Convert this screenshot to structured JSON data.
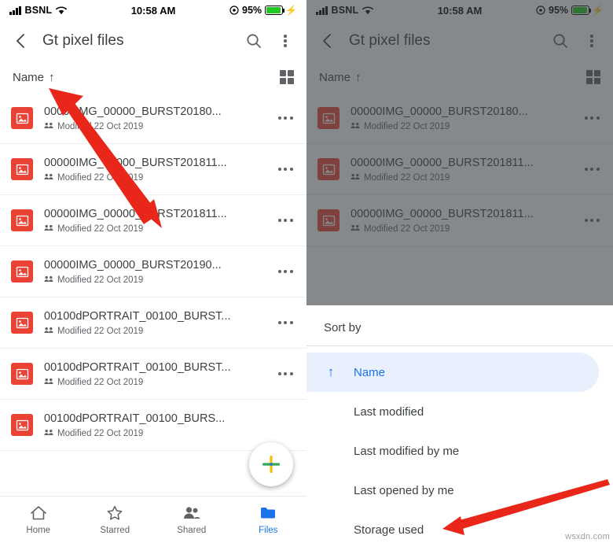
{
  "status_bar": {
    "carrier": "BSNL",
    "time": "10:58 AM",
    "battery": "95%",
    "wifi_icon": "wifi-icon",
    "signal_icon": "signal-bars-icon",
    "battery_icon": "battery-icon",
    "charging_icon": "charging-bolt-icon"
  },
  "app_bar": {
    "title": "Gt pixel files",
    "back_icon": "back-arrow-icon",
    "search_icon": "search-icon",
    "overflow_icon": "more-vertical-icon"
  },
  "sort_row": {
    "label": "Name",
    "arrow": "↑",
    "grid_icon": "grid-view-icon"
  },
  "files": [
    {
      "name": "00000IMG_00000_BURST20180...",
      "meta": "Modified 22 Oct 2019"
    },
    {
      "name": "00000IMG_00000_BURST201811...",
      "meta": "Modified 22 Oct 2019"
    },
    {
      "name": "00000IMG_00000_BURST201811...",
      "meta": "Modified 22 Oct 2019"
    },
    {
      "name": "00000IMG_00000_BURST20190...",
      "meta": "Modified 22 Oct 2019"
    },
    {
      "name": "00100dPORTRAIT_00100_BURST...",
      "meta": "Modified 22 Oct 2019"
    },
    {
      "name": "00100dPORTRAIT_00100_BURST...",
      "meta": "Modified 22 Oct 2019"
    },
    {
      "name": "00100dPORTRAIT_00100_BURS...",
      "meta": "Modified 22 Oct 2019"
    }
  ],
  "fab": {
    "icon": "add-plus-icon"
  },
  "bottom_nav": [
    {
      "label": "Home",
      "icon": "home-icon",
      "active": false
    },
    {
      "label": "Starred",
      "icon": "star-icon",
      "active": false
    },
    {
      "label": "Shared",
      "icon": "people-icon",
      "active": false
    },
    {
      "label": "Files",
      "icon": "folder-icon",
      "active": true
    }
  ],
  "sort_sheet": {
    "title": "Sort by",
    "options": [
      {
        "label": "Name",
        "selected": true
      },
      {
        "label": "Last modified",
        "selected": false
      },
      {
        "label": "Last modified by me",
        "selected": false
      },
      {
        "label": "Last opened by me",
        "selected": false
      },
      {
        "label": "Storage used",
        "selected": false
      }
    ]
  },
  "annotations": {
    "arrow_left": "red-arrow-pointing-to-name-sort",
    "arrow_right": "red-arrow-pointing-to-storage-used"
  },
  "watermark": "wsxdn.com",
  "colors": {
    "accent": "#1a73e8",
    "selected_bg": "#e8f0fe",
    "thumb": "#ea4335",
    "text": "#3c4043",
    "muted": "#5f6368",
    "arrow_red": "#e8271a",
    "fab_green": "#34a853",
    "fab_yellow": "#fbbc04"
  }
}
